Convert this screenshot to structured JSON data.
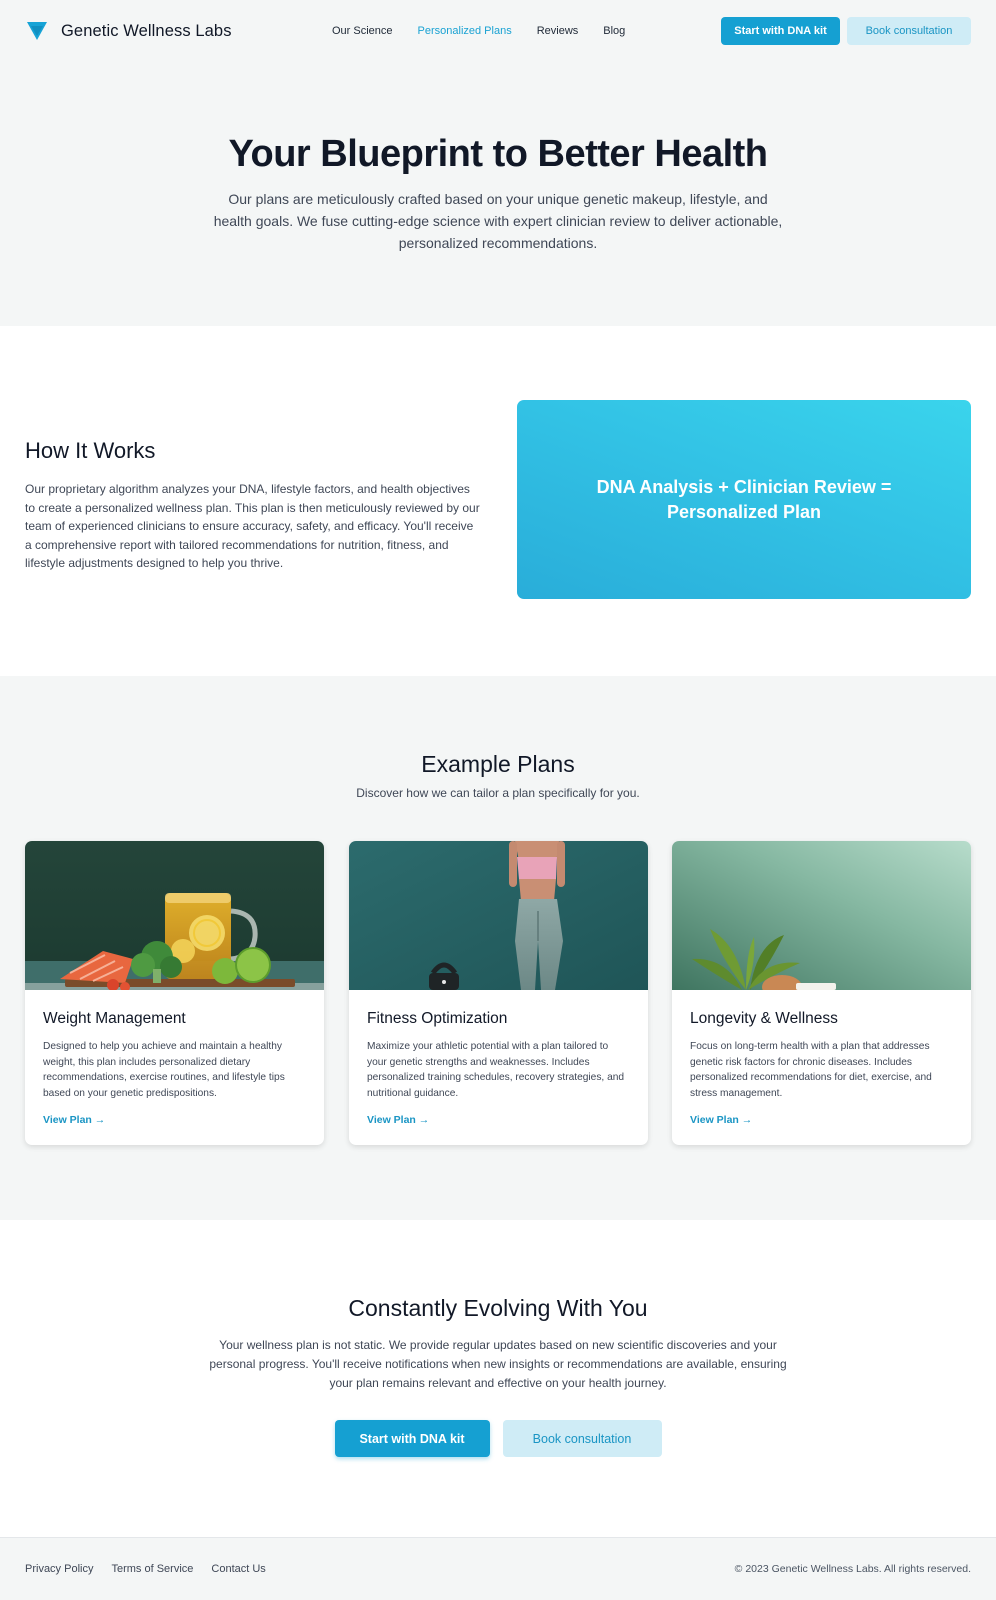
{
  "brand": {
    "name": "Genetic Wellness Labs",
    "logo_icon": "funnel-logo-icon",
    "accent_color": "#15a0d2"
  },
  "nav": {
    "items": [
      {
        "label": "Our Science",
        "active": false
      },
      {
        "label": "Personalized Plans",
        "active": true
      },
      {
        "label": "Reviews",
        "active": false
      },
      {
        "label": "Blog",
        "active": false
      }
    ]
  },
  "header": {
    "primary_cta": "Start with DNA kit",
    "secondary_cta": "Book consultation"
  },
  "hero": {
    "title": "Your Blueprint to Better Health",
    "description": "Our plans are meticulously crafted based on your unique genetic makeup, lifestyle, and health goals. We fuse cutting-edge science with expert clinician review to deliver actionable, personalized recommendations."
  },
  "how": {
    "title": "How It Works",
    "description": "Our proprietary algorithm analyzes your DNA, lifestyle factors, and health objectives to create a personalized wellness plan. This plan is then meticulously reviewed by our team of experienced clinicians to ensure accuracy, safety, and efficacy. You'll receive a comprehensive report with tailored recommendations for nutrition, fitness, and lifestyle adjustments designed to help you thrive.",
    "formula": "DNA Analysis + Clinician Review = Personalized Plan"
  },
  "plans": {
    "title": "Example Plans",
    "subtitle": "Discover how we can tailor a plan specifically for you.",
    "cards": [
      {
        "title": "Weight Management",
        "description": "Designed to help you achieve and maintain a healthy weight, this plan includes personalized dietary recommendations, exercise routines, and lifestyle tips based on your genetic predispositions.",
        "link": "View Plan →",
        "image": "healthy-food-photo"
      },
      {
        "title": "Fitness Optimization",
        "description": "Maximize your athletic potential with a plan tailored to your genetic strengths and weaknesses. Includes personalized training schedules, recovery strategies, and nutritional guidance.",
        "link": "View Plan →",
        "image": "athlete-photo"
      },
      {
        "title": "Longevity & Wellness",
        "description": "Focus on long-term health with a plan that addresses genetic risk factors for chronic diseases. Includes personalized recommendations for diet, exercise, and stress management.",
        "link": "View Plan →",
        "image": "plant-photo"
      }
    ]
  },
  "evolve": {
    "title": "Constantly Evolving With You",
    "description": "Your wellness plan is not static. We provide regular updates based on new scientific discoveries and your personal progress. You'll receive notifications when new insights or recommendations are available, ensuring your plan remains relevant and effective on your health journey.",
    "primary_cta": "Start with DNA kit",
    "secondary_cta": "Book consultation"
  },
  "footer": {
    "links": [
      "Privacy Policy",
      "Terms of Service",
      "Contact Us"
    ],
    "copyright": "© 2023 Genetic Wellness Labs. All rights reserved."
  }
}
